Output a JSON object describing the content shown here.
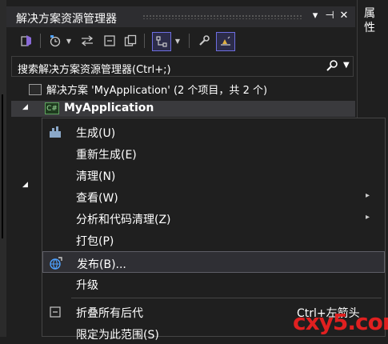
{
  "window": {
    "title": "解决方案资源管理器",
    "pin": "▾",
    "pin2": "⊣",
    "close": "✕"
  },
  "right_rail": {
    "label": "属性"
  },
  "toolbar": {
    "icons": [
      "vs-solution-switch-icon",
      "history-icon",
      "dropdown-arrow-icon",
      "sync-icon",
      "collapse-all-icon",
      "show-all-files-icon",
      "properties-view-icon",
      "dropdown-arrow-icon",
      "wrench-icon",
      "preview-icon"
    ]
  },
  "search": {
    "placeholder": "搜索解决方案资源管理器(Ctrl+;)",
    "icon": "search-icon"
  },
  "tree": {
    "solution": "解决方案 'MyApplication' (2 个项目，共 2 个)",
    "project": "MyApplication",
    "project_badge": "C#"
  },
  "menu": {
    "items": [
      {
        "label": "生成(U)",
        "icon": "build-icon"
      },
      {
        "label": "重新生成(E)"
      },
      {
        "label": "清理(N)"
      },
      {
        "label": "查看(W)",
        "submenu": "▸"
      },
      {
        "label": "分析和代码清理(Z)",
        "submenu": "▸"
      },
      {
        "label": "打包(P)"
      },
      {
        "label": "发布(B)...",
        "icon": "publish-globe-icon"
      },
      {
        "label": "升级"
      },
      {
        "label": "折叠所有后代",
        "icon": "collapse-icon",
        "shortcut": "Ctrl+左箭头"
      },
      {
        "label": "限定为此范围(S)"
      }
    ]
  },
  "watermark": "cxy5.com",
  "colors": {
    "background": "#1f1f1f",
    "accent": "#6d6de0",
    "watermark": "#e02020"
  }
}
